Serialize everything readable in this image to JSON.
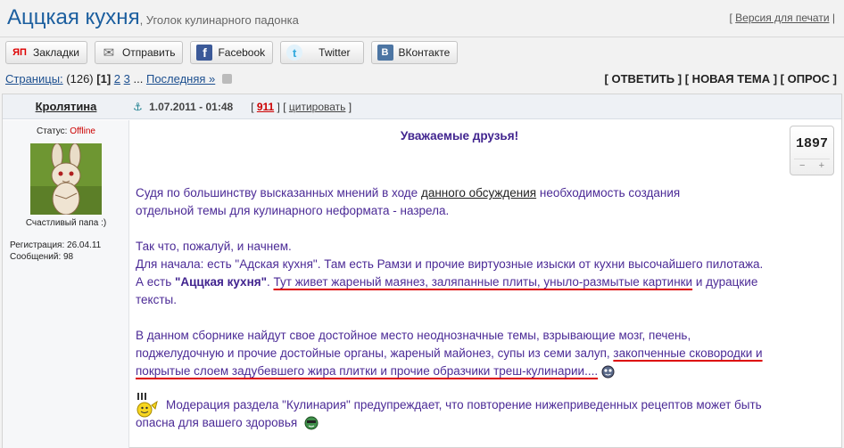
{
  "header": {
    "title": "Аццкая кухня",
    "subtitle": ", Уголок кулинарного падонка",
    "print_open": "[",
    "print_label": "Версия для печати",
    "print_close": "|"
  },
  "share": [
    {
      "label": "Закладки",
      "icon": "yandex-bookmarks-icon",
      "glyph": "ЯП",
      "color": "#d00"
    },
    {
      "label": "Отправить",
      "icon": "email-icon",
      "glyph": "✉",
      "color": "#666"
    },
    {
      "label": "Facebook",
      "icon": "facebook-icon",
      "glyph": "f",
      "color": "#3b5998"
    },
    {
      "label": "Twitter",
      "icon": "twitter-icon",
      "glyph": "t",
      "color": "#33aadd"
    },
    {
      "label": "ВКонтакте",
      "icon": "vkontakte-icon",
      "glyph": "B",
      "color": "#4c75a3"
    }
  ],
  "pager": {
    "label": "Страницы:",
    "count": "(126)",
    "current": "[1]",
    "page2": "2",
    "page3": "3",
    "ellipsis": "...",
    "last": "Последняя »"
  },
  "actions": {
    "reply": "[ ОТВЕТИТЬ ]",
    "new_topic": "[ НОВАЯ ТЕМА ]",
    "poll": "[ ОПРОС ]"
  },
  "post": {
    "author": "Кролятина",
    "status_label": "Статус:",
    "status_value": "Offline",
    "avatar_caption": "Счастливый папа :)",
    "registration": "Регистрация: 26.04.11",
    "messages": "Сообщений: 98",
    "date": "1.07.2011 - 01:48",
    "number": "911",
    "cite": "цитировать",
    "rating": "1897",
    "rating_minus": "−",
    "rating_plus": "+",
    "greeting": "Уважаемые друзья!",
    "p1_pre": "Судя по большинству высказанных мнений в ходе ",
    "p1_link": "данного обсуждения",
    "p1_post": " необходимость создания",
    "p1_line2": "отдельной темы для кулинарного неформата - назрела.",
    "p2_line1": "Так что, пожалуй, и начнем.",
    "p2_line2": "Для начала: есть \"Адская кухня\". Там есть Рамзи и прочие виртуозные изыски от кухни высочайшего пилотажа.",
    "p2_line3_pre": "А есть ",
    "p2_line3_bold": "\"Аццкая кухня\"",
    "p2_line3_mid": ". ",
    "p2_line3_ul": "Тут живет жареный маянез, заляпанные плиты, уныло-размытые картинки",
    "p2_line3_post": " и дурацкие",
    "p2_line4": "тексты.",
    "p3_line1": "В данном сборнике найдут свое достойное место неоднозначные темы, взрывающие мозг, печень,",
    "p3_line2_pre": "поджелудочную и прочие достойные органы, жареный майонез, супы из семи залуп, ",
    "p3_line2_ul": "закопченные сковородки и",
    "p3_line3": "покрытые слоем задубевшего жира плитки и прочие образчики треш-кулинарии....",
    "p4_line1": "Модерация раздела \"Кулинария\" предупреждает, что повторение нижеприведенных рецептов может быть",
    "p4_line2": "опасна для вашего здоровья"
  }
}
